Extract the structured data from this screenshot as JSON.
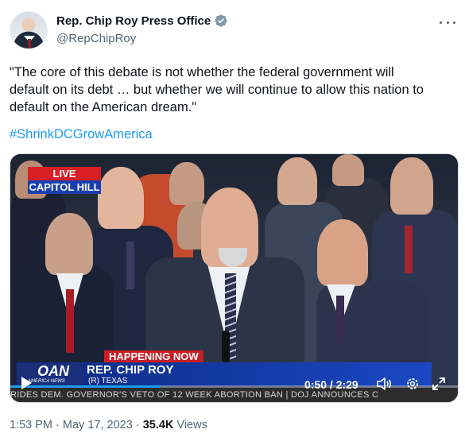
{
  "tweet": {
    "display_name": "Rep. Chip Roy Press Office",
    "handle": "@RepChipRoy",
    "text_line1": "\"The core of this debate is not whether the federal government will",
    "text_line2": "default on its debt … but whether we will continue to allow this nation to",
    "text_line3": "default on the American dream.\"",
    "hashtag": "#ShrinkDCGrowAmerica",
    "time": "1:53 PM",
    "separator": "·",
    "date": "May 17, 2023",
    "views_count": "35.4K",
    "views_label": "Views"
  },
  "video": {
    "live_label": "LIVE",
    "location_label": "CAPITOL HILL",
    "happening_label": "HAPPENING NOW",
    "network_logo": "OAN",
    "network_sub": "AMERICA NEWS",
    "lower_third_name": "REP. CHIP ROY",
    "lower_third_sub": "(R) TEXAS",
    "ticker": "RIDES DEM. GOVERNOR'S VETO OF 12 WEEK ABORTION BAN  |  DOJ ANNOUNCES C",
    "time_display": "0:50 / 2:29",
    "progress_fraction": 0.335
  },
  "colors": {
    "link": "#1d9bf0",
    "text": "#0f1419",
    "muted": "#536471",
    "verified": "#829aab"
  },
  "icons": [
    "verified-badge-icon",
    "more-icon",
    "play-icon",
    "volume-icon",
    "settings-icon",
    "fullscreen-icon"
  ]
}
